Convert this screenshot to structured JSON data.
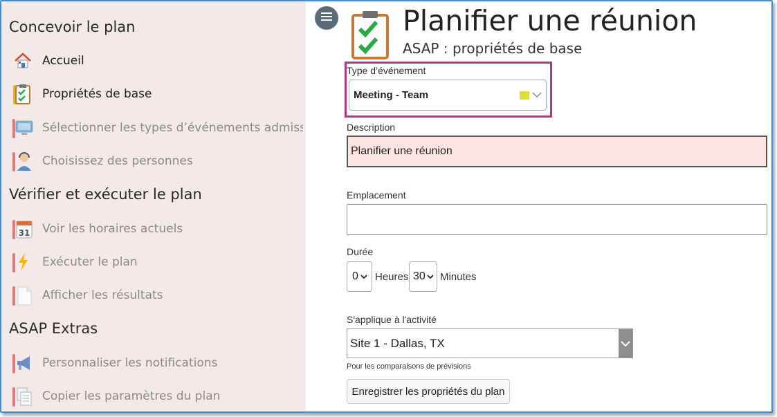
{
  "sidebar": {
    "sections": [
      {
        "title": "Concevoir le plan"
      },
      {
        "title": "Vérifier et exécuter le plan"
      },
      {
        "title": "ASAP Extras"
      }
    ],
    "items": [
      {
        "label": "Accueil",
        "icon": "home-icon"
      },
      {
        "label": "Propriétés de base",
        "icon": "clipboard-check-icon"
      },
      {
        "label": "Sélectionner les types d’événements admissibles",
        "icon": "screen-icon"
      },
      {
        "label": "Choisissez des personnes",
        "icon": "person-headset-icon"
      },
      {
        "label": "Voir les horaires actuels",
        "icon": "calendar-icon"
      },
      {
        "label": "Exécuter le plan",
        "icon": "lightning-icon"
      },
      {
        "label": "Afficher les résultats",
        "icon": "document-icon"
      },
      {
        "label": "Personnaliser les notifications",
        "icon": "megaphone-icon"
      },
      {
        "label": "Copier les paramètres du plan",
        "icon": "copy-document-icon"
      }
    ]
  },
  "header": {
    "title": "Planifier une réunion",
    "subtitle": "ASAP : propriétés de base"
  },
  "form": {
    "event_type": {
      "label": "Type d’événement",
      "value": "Meeting - Team",
      "swatch_color": "#dede3a"
    },
    "description": {
      "label": "Description",
      "value": "Planifier une réunion"
    },
    "location": {
      "label": "Emplacement",
      "value": ""
    },
    "duration": {
      "label": "Durée",
      "hours": "0",
      "hours_unit": "Heures",
      "minutes": "30",
      "minutes_unit": "Minutes"
    },
    "activity": {
      "label": "S'applique à l'activité",
      "value": "Site 1 - Dallas, TX",
      "hint": "Pour les comparaisons de prévisions"
    },
    "save_label": "Enregistrer les propriétés du plan"
  },
  "colors": {
    "sidebar_bg": "#f3e9e9",
    "highlight": "#b3358a",
    "description_bg": "#fde4e1",
    "frame_border": "#3b8fd6"
  }
}
